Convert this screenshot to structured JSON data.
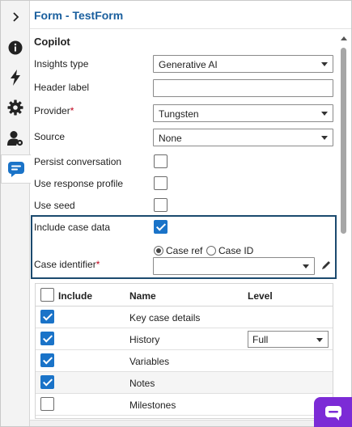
{
  "form": {
    "title": "Form - TestForm"
  },
  "section": {
    "title": "Copilot"
  },
  "rail": {
    "items": [
      {
        "name": "expand",
        "icon": "chevron-right-icon"
      },
      {
        "name": "info",
        "icon": "info-icon"
      },
      {
        "name": "actions",
        "icon": "lightning-icon"
      },
      {
        "name": "settings",
        "icon": "gear-icon"
      },
      {
        "name": "users",
        "icon": "user-settings-icon"
      },
      {
        "name": "copilot",
        "icon": "copilot-chat-icon"
      }
    ]
  },
  "fields": {
    "insights_type": {
      "label": "Insights type",
      "value": "Generative AI"
    },
    "header_label": {
      "label": "Header label",
      "value": ""
    },
    "provider": {
      "label": "Provider",
      "required": "*",
      "value": "Tungsten"
    },
    "source": {
      "label": "Source",
      "value": "None"
    },
    "persist_conversation": {
      "label": "Persist conversation",
      "checked": false
    },
    "use_response_profile": {
      "label": "Use response profile",
      "checked": false
    },
    "use_seed": {
      "label": "Use seed",
      "checked": false
    },
    "include_case_data": {
      "label": "Include case data",
      "checked": true
    },
    "case_identifier": {
      "label": "Case identifier",
      "required": "*",
      "value": "",
      "options": {
        "case_ref": "Case ref",
        "case_id": "Case ID"
      },
      "selected": "case_ref"
    }
  },
  "table": {
    "headers": {
      "include": "Include",
      "name": "Name",
      "level": "Level"
    },
    "rows": [
      {
        "include": true,
        "name": "Key case details",
        "level": ""
      },
      {
        "include": true,
        "name": "History",
        "level": "Full"
      },
      {
        "include": true,
        "name": "Variables",
        "level": ""
      },
      {
        "include": true,
        "name": "Notes",
        "level": ""
      },
      {
        "include": false,
        "name": "Milestones",
        "level": ""
      }
    ]
  },
  "colors": {
    "accent": "#1a73c8",
    "title": "#1a5f9e",
    "highlight_border": "#1b4a6e",
    "copilot": "#7c2bd6",
    "required": "#c0001a"
  }
}
